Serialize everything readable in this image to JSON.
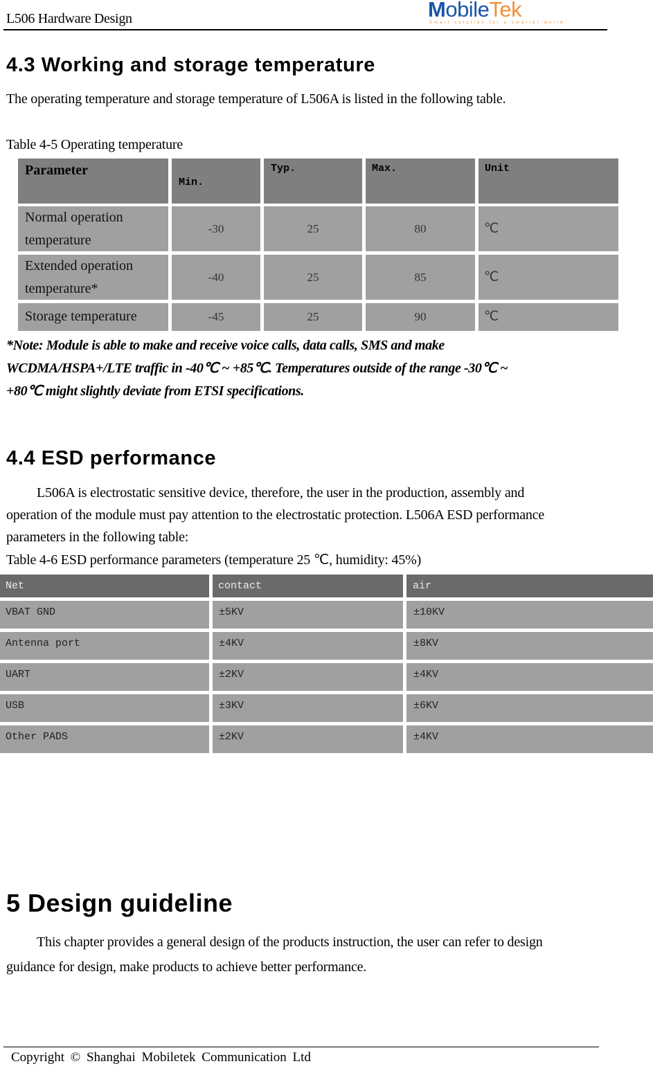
{
  "header": {
    "doc_title": "L506 Hardware Design",
    "logo": {
      "brand_m": "M",
      "brand_obile": "obile",
      "brand_tek": "Tek",
      "tagline": "Smart solution for a smarter world",
      "colors": {
        "primary": "#1a55a8",
        "accent": "#f0913a"
      }
    }
  },
  "section_4_3": {
    "heading": "4.3 Working and storage temperature",
    "intro": "The operating temperature and storage temperature of L506A is listed in the following table.",
    "table_caption": "Table 4-5 Operating temperature",
    "table": {
      "headers": [
        "Parameter",
        "Min.",
        "Typ.",
        "Max.",
        "Unit"
      ],
      "rows": [
        {
          "parameter_line1": "Normal operation",
          "parameter_line2": "temperature",
          "min": "-30",
          "typ": "25",
          "max": "80",
          "unit": "℃"
        },
        {
          "parameter_line1": "Extended operation",
          "parameter_line2": "temperature*",
          "min": "-40",
          "typ": "25",
          "max": "85",
          "unit": "℃"
        },
        {
          "parameter_line1": "Storage temperature",
          "parameter_line2": "",
          "min": "-45",
          "typ": "25",
          "max": "90",
          "unit": "℃"
        }
      ]
    },
    "note_lines": [
      "*Note: Module is able to make and receive voice calls, data calls, SMS and make",
      "WCDMA/HSPA+/LTE traffic in -40℃  ~ +85℃. Temperatures outside of the range -30℃  ~",
      "+80℃  might slightly deviate from ETSI specifications."
    ]
  },
  "section_4_4": {
    "heading": "4.4 ESD performance",
    "para_lines": [
      "L506A is electrostatic sensitive device, therefore, the user in the production, assembly and",
      "operation of the module must pay attention to the electrostatic protection. L506A ESD performance",
      "parameters in the following table:"
    ],
    "table_caption": "Table 4-6 ESD performance parameters (temperature 25  ℃, humidity: 45%)",
    "table": {
      "headers": [
        "Net",
        "contact",
        "air"
      ],
      "rows": [
        {
          "net": "VBAT GND",
          "contact": "±5KV",
          "air": "±10KV"
        },
        {
          "net": "Antenna port",
          "contact": "±4KV",
          "air": "±8KV"
        },
        {
          "net": "UART",
          "contact": "±2KV",
          "air": "±4KV"
        },
        {
          "net": "USB",
          "contact": "±3KV",
          "air": "±6KV"
        },
        {
          "net": "Other PADS",
          "contact": "±2KV",
          "air": "±4KV"
        }
      ]
    }
  },
  "section_5": {
    "heading": "5 Design guideline",
    "para_lines": [
      "This chapter provides a general design of the products instruction, the user can refer to design",
      "guidance for design, make products to achieve better performance."
    ]
  },
  "footer": {
    "copyright": "Copyright  ©  Shanghai  Mobiletek  Communication  Ltd"
  }
}
